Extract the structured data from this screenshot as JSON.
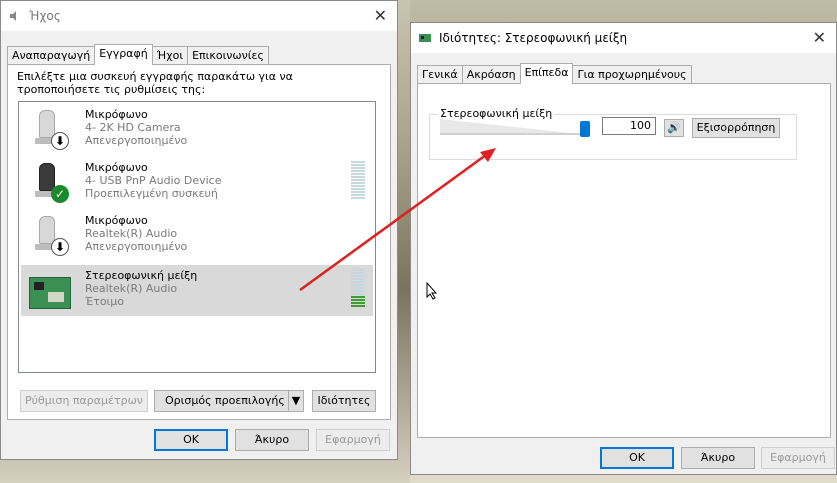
{
  "sound_dialog": {
    "title": "Ήχος",
    "tabs": [
      "Αναπαραγωγή",
      "Εγγραφή",
      "Ήχοι",
      "Επικοινωνίες"
    ],
    "active_tab": 1,
    "instruction": "Επιλέξτε μια συσκευή εγγραφής παρακάτω για να τροποποιήσετε τις ρυθμίσεις της:",
    "devices": [
      {
        "name": "Μικρόφωνο",
        "detail": "4- 2K HD Camera",
        "status": "Απενεργοποιημένο",
        "icon": "microphone-disabled-icon"
      },
      {
        "name": "Μικρόφωνο",
        "detail": "4- USB PnP Audio Device",
        "status": "Προεπιλεγμένη συσκευή",
        "icon": "microphone-default-icon"
      },
      {
        "name": "Μικρόφωνο",
        "detail": "Realtek(R) Audio",
        "status": "Απενεργοποιημένο",
        "icon": "microphone-disabled-icon"
      },
      {
        "name": "Στερεοφωνική μείξη",
        "detail": "Realtek(R) Audio",
        "status": "Έτοιμο",
        "icon": "sound-card-icon"
      }
    ],
    "buttons": {
      "configure": "Ρύθμιση παραμέτρων",
      "set_default": "Ορισμός προεπιλογής",
      "properties": "Ιδιότητες",
      "ok": "OK",
      "cancel": "Άκυρο",
      "apply": "Εφαρμογή"
    }
  },
  "props_dialog": {
    "title": "Ιδιότητες: Στερεοφωνική μείξη",
    "tabs": [
      "Γενικά",
      "Ακρόαση",
      "Επίπεδα",
      "Για προχωρημένους"
    ],
    "active_tab": 2,
    "level_group_label": "Στερεοφωνική μείξη",
    "level_value": "100",
    "level_fraction": 1.0,
    "balance_button": "Εξισορρόπηση",
    "buttons": {
      "ok": "OK",
      "cancel": "Άκυρο",
      "apply": "Εφαρμογή"
    }
  },
  "colors": {
    "accent": "#0078d7",
    "arrow": "#e02020",
    "meter_on": "#3e9c35"
  }
}
